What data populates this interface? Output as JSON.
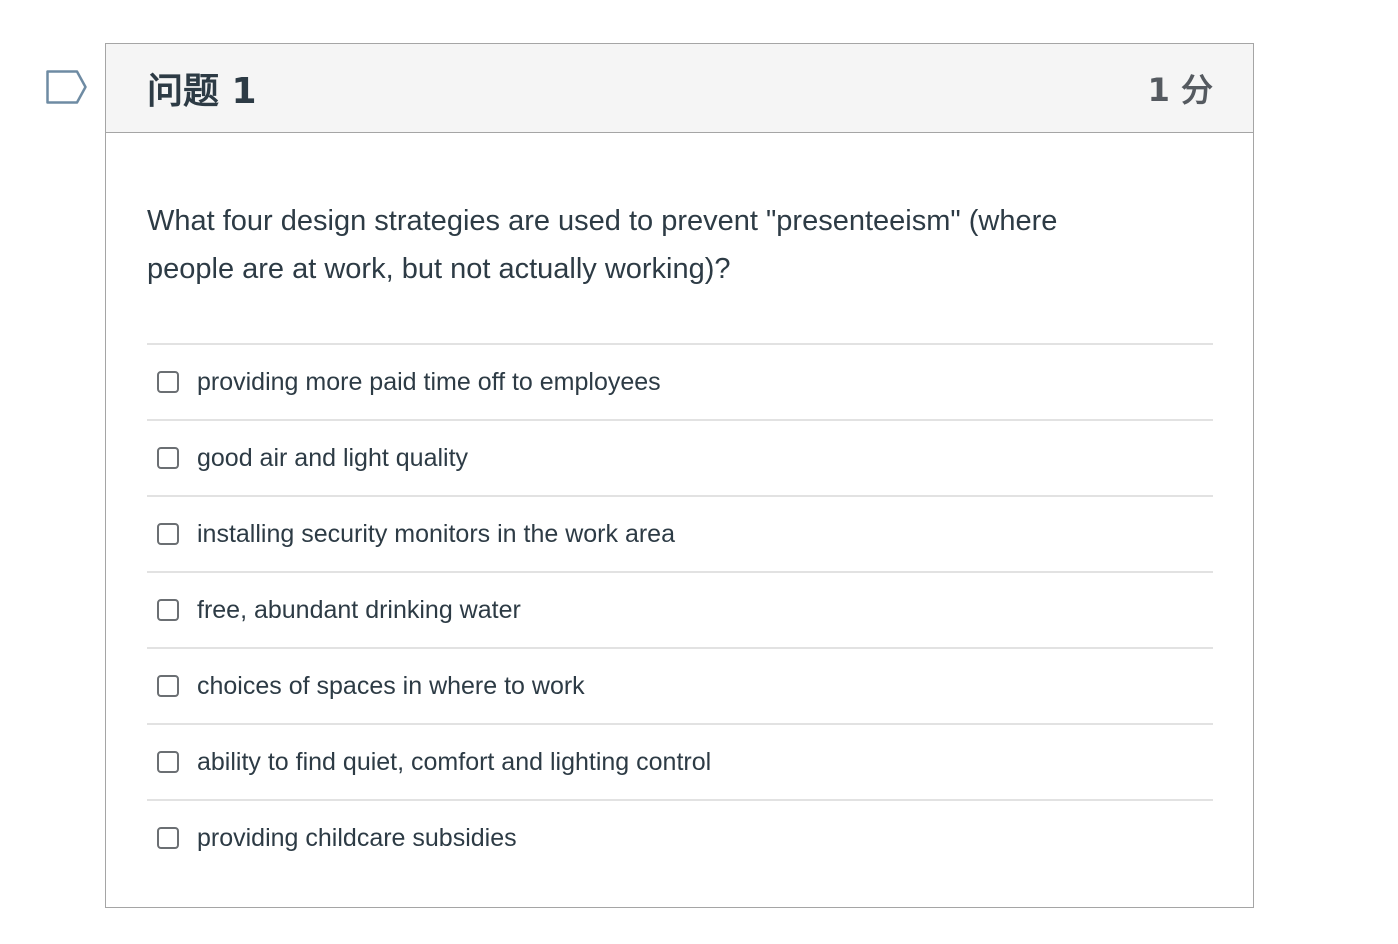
{
  "question": {
    "title": "问题 1",
    "points": "1 分",
    "text": "What four design strategies are used to prevent \"presenteeism\" (where people are at work, but not actually working)?",
    "flag_icon": "flag-icon",
    "answers": [
      {
        "label": "providing more paid time off to employees",
        "checked": false
      },
      {
        "label": "good air and light quality",
        "checked": false
      },
      {
        "label": "installing security monitors in the work area",
        "checked": false
      },
      {
        "label": "free, abundant drinking water",
        "checked": false
      },
      {
        "label": "choices of spaces in where to work",
        "checked": false
      },
      {
        "label": "ability to find quiet, comfort and lighting control",
        "checked": false
      },
      {
        "label": "providing childcare subsidies",
        "checked": false
      }
    ]
  }
}
